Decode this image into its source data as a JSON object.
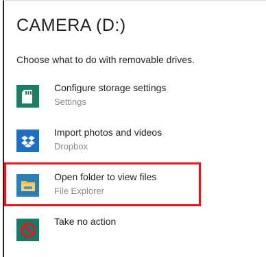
{
  "dialog": {
    "title": "CAMERA (D:)",
    "subtitle": "Choose what to do with removable drives."
  },
  "options": [
    {
      "label": "Configure storage settings",
      "sub": "Settings",
      "icon": "sd-card-icon"
    },
    {
      "label": "Import photos and videos",
      "sub": "Dropbox",
      "icon": "dropbox-icon"
    },
    {
      "label": "Open folder to view files",
      "sub": "File Explorer",
      "icon": "folder-icon"
    },
    {
      "label": "Take no action",
      "icon": "no-action-icon"
    }
  ],
  "colors": {
    "settings_tile": "#1a7f66",
    "dropbox_tile": "#1e6fc4",
    "explorer_tile": "#2a7fb8",
    "noaction_tile": "#177a66",
    "highlight": "#e8141c"
  }
}
